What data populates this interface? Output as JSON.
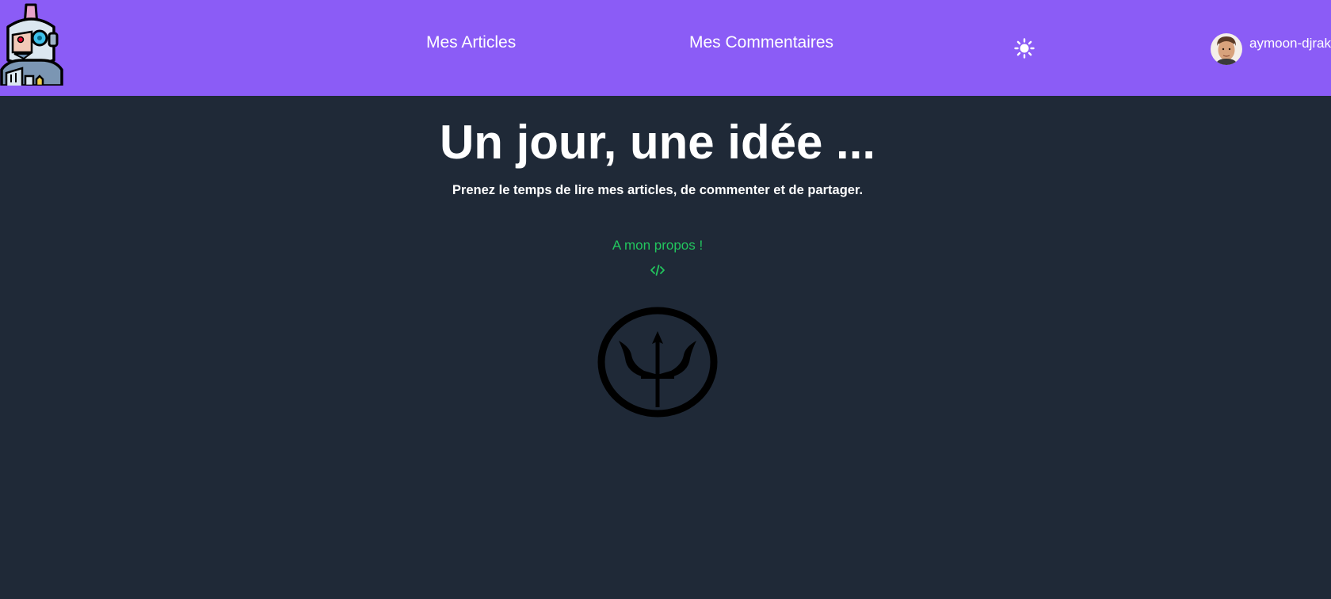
{
  "header": {
    "logo_icon": "robot-avatar-logo",
    "nav": {
      "articles_label": "Mes Articles",
      "comments_label": "Mes Commentaires"
    },
    "theme_toggle_icon": "sun-icon",
    "user": {
      "username": "aymoon-djrak",
      "avatar_icon": "user-avatar"
    }
  },
  "hero": {
    "title": "Un jour, une idée ...",
    "subtitle": "Prenez le temps de lire mes articles, de commenter et de partager.",
    "about_label": "A mon propos !",
    "code_icon": "code-icon",
    "emblem_icon": "trident-circle-icon"
  },
  "colors": {
    "navbar": "#8b5cf6",
    "background": "#1f2937",
    "text": "#ffffff",
    "accent_green": "#22c55e",
    "emblem": "#000000"
  }
}
